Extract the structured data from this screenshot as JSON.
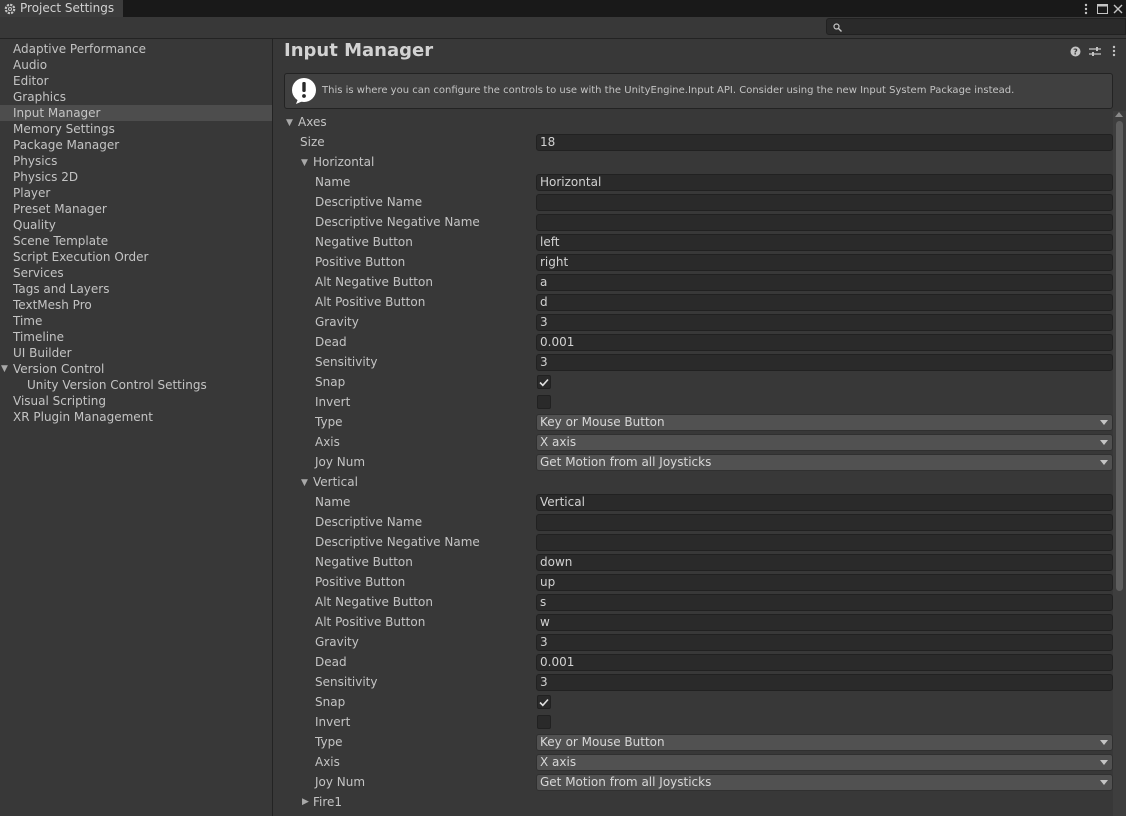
{
  "window": {
    "tab_title": "Project Settings",
    "tab_icon": "gear-icon",
    "menu_icon": "kebab-menu-icon",
    "maximize_icon": "maximize-icon",
    "close_icon": "close-icon"
  },
  "search": {
    "icon": "search-icon",
    "placeholder": ""
  },
  "sidebar": {
    "items": [
      {
        "label": "Adaptive Performance"
      },
      {
        "label": "Audio"
      },
      {
        "label": "Editor"
      },
      {
        "label": "Graphics"
      },
      {
        "label": "Input Manager",
        "selected": true
      },
      {
        "label": "Memory Settings"
      },
      {
        "label": "Package Manager"
      },
      {
        "label": "Physics"
      },
      {
        "label": "Physics 2D"
      },
      {
        "label": "Player"
      },
      {
        "label": "Preset Manager"
      },
      {
        "label": "Quality"
      },
      {
        "label": "Scene Template"
      },
      {
        "label": "Script Execution Order"
      },
      {
        "label": "Services"
      },
      {
        "label": "Tags and Layers"
      },
      {
        "label": "TextMesh Pro"
      },
      {
        "label": "Time"
      },
      {
        "label": "Timeline"
      },
      {
        "label": "UI Builder"
      },
      {
        "label": "Version Control",
        "expanded": true
      },
      {
        "label": "Unity Version Control Settings",
        "child": true
      },
      {
        "label": "Visual Scripting"
      },
      {
        "label": "XR Plugin Management"
      }
    ]
  },
  "main": {
    "title": "Input Manager",
    "header_icons": [
      "help-icon",
      "presets-icon",
      "kebab-menu-icon"
    ],
    "help_message": "This is where you can configure the controls to use with the UnityEngine.Input API. Consider using the new Input System Package instead.",
    "axes": {
      "label": "Axes",
      "size_label": "Size",
      "size_value": "18",
      "horizontal": {
        "label": "Horizontal",
        "name_label": "Name",
        "name": "Horizontal",
        "descriptive_name_label": "Descriptive Name",
        "descriptive_name": "",
        "descriptive_negative_name_label": "Descriptive Negative Name",
        "descriptive_negative_name": "",
        "negative_button_label": "Negative Button",
        "negative_button": "left",
        "positive_button_label": "Positive Button",
        "positive_button": "right",
        "alt_negative_button_label": "Alt Negative Button",
        "alt_negative_button": "a",
        "alt_positive_button_label": "Alt Positive Button",
        "alt_positive_button": "d",
        "gravity_label": "Gravity",
        "gravity": "3",
        "dead_label": "Dead",
        "dead": "0.001",
        "sensitivity_label": "Sensitivity",
        "sensitivity": "3",
        "snap_label": "Snap",
        "snap": true,
        "invert_label": "Invert",
        "invert": false,
        "type_label": "Type",
        "type": "Key or Mouse Button",
        "axis_label": "Axis",
        "axis": "X axis",
        "joy_num_label": "Joy Num",
        "joy_num": "Get Motion from all Joysticks"
      },
      "vertical": {
        "label": "Vertical",
        "name_label": "Name",
        "name": "Vertical",
        "descriptive_name_label": "Descriptive Name",
        "descriptive_name": "",
        "descriptive_negative_name_label": "Descriptive Negative Name",
        "descriptive_negative_name": "",
        "negative_button_label": "Negative Button",
        "negative_button": "down",
        "positive_button_label": "Positive Button",
        "positive_button": "up",
        "alt_negative_button_label": "Alt Negative Button",
        "alt_negative_button": "s",
        "alt_positive_button_label": "Alt Positive Button",
        "alt_positive_button": "w",
        "gravity_label": "Gravity",
        "gravity": "3",
        "dead_label": "Dead",
        "dead": "0.001",
        "sensitivity_label": "Sensitivity",
        "sensitivity": "3",
        "snap_label": "Snap",
        "snap": true,
        "invert_label": "Invert",
        "invert": false,
        "type_label": "Type",
        "type": "Key or Mouse Button",
        "axis_label": "Axis",
        "axis": "X axis",
        "joy_num_label": "Joy Num",
        "joy_num": "Get Motion from all Joysticks"
      },
      "fire1": {
        "label": "Fire1"
      }
    }
  }
}
